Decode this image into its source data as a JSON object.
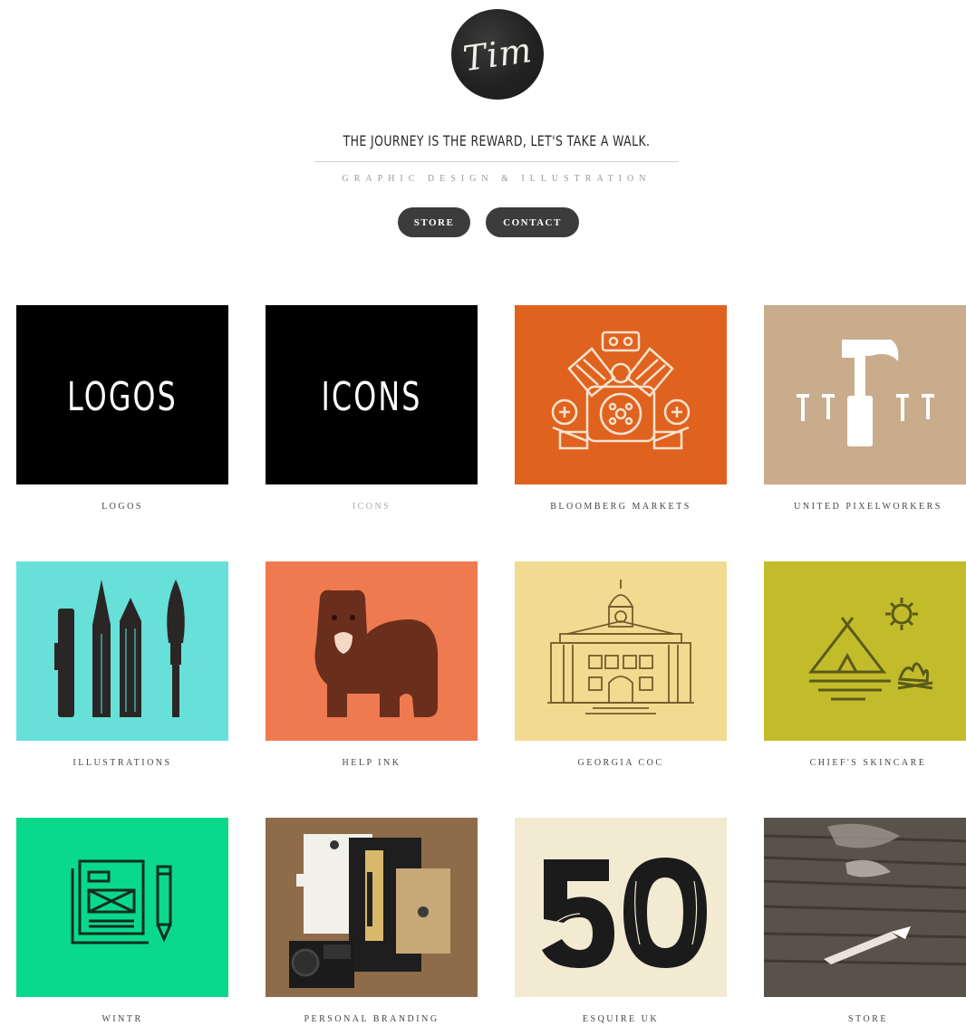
{
  "header": {
    "logo_text": "Tim",
    "tagline": "THE JOURNEY IS THE REWARD, LET'S TAKE A WALK.",
    "subtitle": "GRAPHIC DESIGN & ILLUSTRATION",
    "nav": [
      {
        "label": "STORE"
      },
      {
        "label": "CONTACT"
      }
    ]
  },
  "portfolio": {
    "items": [
      {
        "caption": "LOGOS",
        "tile_text": "LOGOS",
        "bg": "#000000"
      },
      {
        "caption": "ICONS",
        "tile_text": "ICONS",
        "bg": "#000000"
      },
      {
        "caption": "BLOOMBERG MARKETS",
        "bg": "#e0621f",
        "icon": "engine-icon"
      },
      {
        "caption": "UNITED PIXELWORKERS",
        "bg": "#c8ac8c",
        "icon": "hammer-nails-icon"
      },
      {
        "caption": "ILLUSTRATIONS",
        "bg": "#66e0d8",
        "icon": "art-tools-icon"
      },
      {
        "caption": "HELP INK",
        "bg": "#ef7a50",
        "icon": "bear-icon"
      },
      {
        "caption": "GEORGIA COC",
        "bg": "#f0db90",
        "icon": "capitol-building-icon"
      },
      {
        "caption": "CHIEF'S SKINCARE",
        "bg": "#c3bc2a",
        "icon": "tent-campfire-icon"
      },
      {
        "caption": "WINTR",
        "bg": "#0ad98c",
        "icon": "newspaper-pencil-icon"
      },
      {
        "caption": "PERSONAL BRANDING",
        "bg": "#8a6a48",
        "icon": "stationery-photo-icon"
      },
      {
        "caption": "ESQUIRE UK",
        "bg": "#f3ead2",
        "icon": "number-50-icon"
      },
      {
        "caption": "STORE",
        "bg": "#5a564e",
        "icon": "craft-knife-photo-icon"
      }
    ]
  }
}
